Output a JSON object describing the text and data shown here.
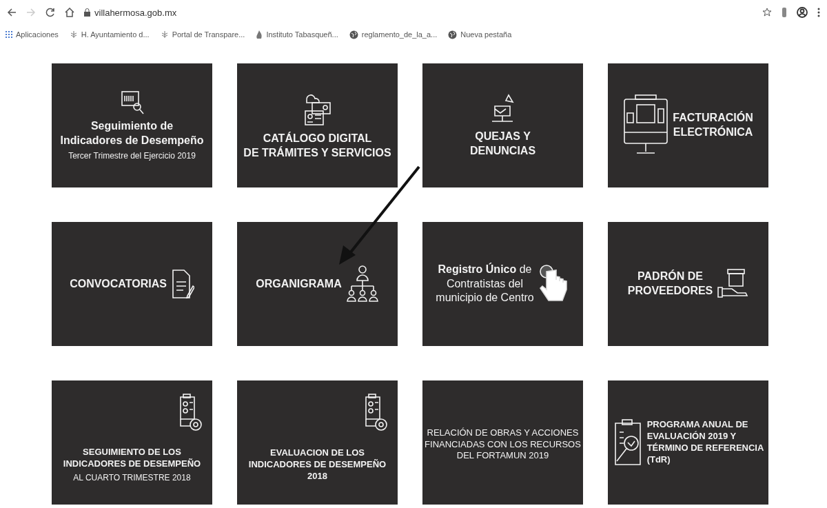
{
  "browser": {
    "url": "villahermosa.gob.mx",
    "forward_disabled": true
  },
  "bookmarks": [
    {
      "kind": "apps",
      "label": "Aplicaciones"
    },
    {
      "kind": "tree",
      "label": "H. Ayuntamiento d..."
    },
    {
      "kind": "tree",
      "label": "Portal de Transpare..."
    },
    {
      "kind": "flame",
      "label": "Instituto Tabasqueñ..."
    },
    {
      "kind": "globe",
      "label": "reglamento_de_la_a..."
    },
    {
      "kind": "globe",
      "label": "Nueva pestaña"
    }
  ],
  "tiles": [
    {
      "kind": "report",
      "title": "Seguimiento de\nIndicadores de Desempeño",
      "subtitle": "Tercer Trimestre del Ejercicio 2019"
    },
    {
      "kind": "catalog",
      "title": "CATÁLOGO DIGITAL\nDE TRÁMITES Y SERVICIOS"
    },
    {
      "kind": "mailbox",
      "title": "QUEJAS Y\nDENUNCIAS"
    },
    {
      "kind": "terminal",
      "title": "FACTURACIÓN\nELECTRÓNICA"
    },
    {
      "kind": "document",
      "title": "CONVOCATORIAS"
    },
    {
      "kind": "org",
      "title": "ORGANIGRAMA"
    },
    {
      "kind": "touch",
      "title": "**Registro Único** de\nContratistas del\nmunicipio de Centro"
    },
    {
      "kind": "delivery",
      "title": "PADRÓN DE\nPROVEEDORES"
    },
    {
      "kind": "checklist",
      "title": "SEGUIMIENTO DE LOS\nINDICADORES DE DESEMPEÑO",
      "subtitle": "AL CUARTO TRIMESTRE 2018"
    },
    {
      "kind": "checklist",
      "title": "EVALUACION DE LOS\nINDICADORES DE DESEMPEÑO\n2018"
    },
    {
      "kind": "plain",
      "title": "RELACIÓN DE OBRAS Y ACCIONES\nFINANCIADAS CON LOS RECURSOS\nDEL FORTAMUN 2019"
    },
    {
      "kind": "clipboard",
      "title": "PROGRAMA ANUAL DE\nEVALUACIÓN 2019 Y\nTÉRMINO DE REFERENCIA\n(TdR)"
    }
  ]
}
